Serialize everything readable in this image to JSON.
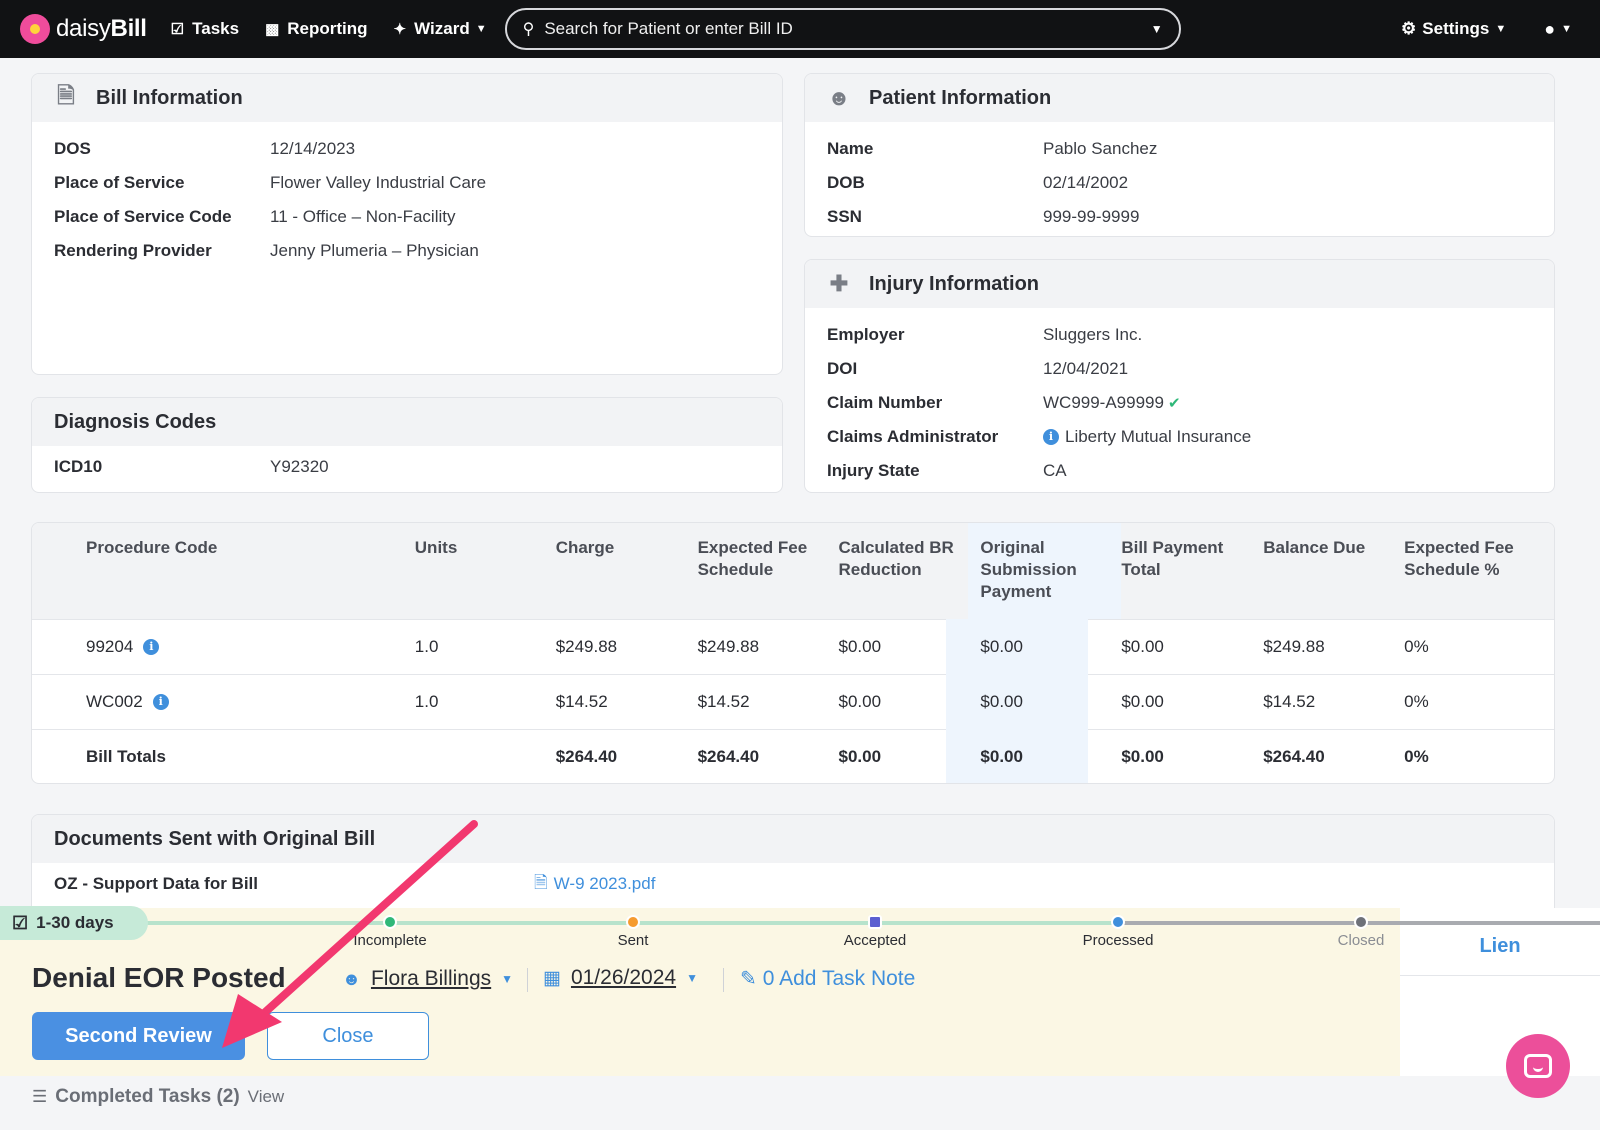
{
  "nav": {
    "brand_prefix": "daisy",
    "brand_suffix": "Bill",
    "tasks": "Tasks",
    "reporting": "Reporting",
    "wizard": "Wizard",
    "search_placeholder": "Search for Patient or enter Bill ID",
    "settings": "Settings"
  },
  "bill_info": {
    "title": "Bill Information",
    "rows": [
      {
        "label": "DOS",
        "value": "12/14/2023"
      },
      {
        "label": "Place of Service",
        "value": "Flower Valley Industrial Care"
      },
      {
        "label": "Place of Service Code",
        "value": "11 - Office – Non-Facility"
      },
      {
        "label": "Rendering Provider",
        "value": "Jenny Plumeria – Physician"
      }
    ]
  },
  "patient_info": {
    "title": "Patient Information",
    "rows": [
      {
        "label": "Name",
        "value": "Pablo Sanchez"
      },
      {
        "label": "DOB",
        "value": "02/14/2002"
      },
      {
        "label": "SSN",
        "value": "999-99-9999"
      }
    ]
  },
  "injury_info": {
    "title": "Injury Information",
    "rows": [
      {
        "label": "Employer",
        "value": "Sluggers Inc."
      },
      {
        "label": "DOI",
        "value": "12/04/2021"
      },
      {
        "label": "Claim Number",
        "value": "WC999-A99999"
      },
      {
        "label": "Claims Administrator",
        "value": "Liberty Mutual Insurance"
      },
      {
        "label": "Injury State",
        "value": "CA"
      }
    ]
  },
  "diagnosis": {
    "title": "Diagnosis Codes",
    "rows": [
      {
        "label": "ICD10",
        "value": "Y92320"
      }
    ]
  },
  "procedures": {
    "headers": [
      "Procedure Code",
      "Units",
      "Charge",
      "Expected Fee Schedule",
      "Calculated BR Reduction",
      "Original Submission Payment",
      "Bill Payment Total",
      "Balance Due",
      "Expected Fee Schedule %"
    ],
    "rows": [
      {
        "code": "99204",
        "units": "1.0",
        "charge": "$249.88",
        "expected": "$249.88",
        "br": "$0.00",
        "orig": "$0.00",
        "payment": "$0.00",
        "balance": "$249.88",
        "pct": "0%"
      },
      {
        "code": "WC002",
        "units": "1.0",
        "charge": "$14.52",
        "expected": "$14.52",
        "br": "$0.00",
        "orig": "$0.00",
        "payment": "$0.00",
        "balance": "$14.52",
        "pct": "0%"
      }
    ],
    "totals": {
      "label": "Bill Totals",
      "charge": "$264.40",
      "expected": "$264.40",
      "br": "$0.00",
      "orig": "$0.00",
      "payment": "$0.00",
      "balance": "$264.40",
      "pct": "0%"
    }
  },
  "documents": {
    "title": "Documents Sent with Original Bill",
    "rows": [
      {
        "label": "OZ - Support Data for Bill",
        "file": "W-9 2023.pdf"
      }
    ]
  },
  "task": {
    "days": "1-30 days",
    "steps": [
      "Incomplete",
      "Sent",
      "Accepted",
      "Processed",
      "Closed"
    ],
    "title": "Denial EOR Posted",
    "assignee": "Flora Billings",
    "due_date": "01/26/2024",
    "note": "0 Add Task Note",
    "primary_button": "Second Review",
    "secondary_button": "Close",
    "lien": "Lien",
    "completed_label": "Completed Tasks (2)",
    "completed_view": "View"
  },
  "colors": {
    "accent": "#4a90e2",
    "annotation_arrow": "#f2386f",
    "topbar": "#111214"
  }
}
